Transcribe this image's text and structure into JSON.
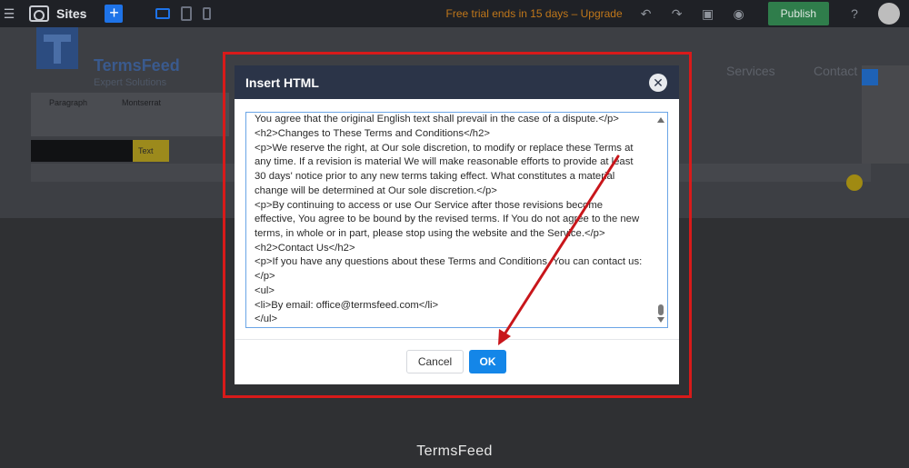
{
  "topbar": {
    "sites_label": "Sites",
    "trial_text": "Free trial ends in 15 days – Upgrade",
    "publish_label": "Publish"
  },
  "website": {
    "brand_name": "TermsFeed",
    "brand_tagline": "Expert Solutions",
    "nav": [
      "Services",
      "Contact"
    ],
    "toolbar_paragraph": "Paragraph",
    "toolbar_font": "Montserrat",
    "text_tag": "Text",
    "footer_brand": "TermsFeed"
  },
  "modal": {
    "title": "Insert HTML",
    "lines": [
      "You agree that the original English text shall prevail in the case of a dispute.</p>",
      "<h2>Changes to These Terms and Conditions</h2>",
      "<p>We reserve the right, at Our sole discretion, to modify or replace these Terms at",
      "any time. If a revision is material We will make reasonable efforts to provide at least",
      "30 days' notice prior to any new terms taking effect. What constitutes a material",
      "change will be determined at Our sole discretion.</p>",
      "<p>By continuing to access or use Our Service after those revisions become",
      "effective, You agree to be bound by the revised terms. If You do not agree to the new",
      "terms, in whole or in part, please stop using the website and the Service.</p>",
      "<h2>Contact Us</h2>",
      "<p>If you have any questions about these Terms and Conditions, You can contact us:",
      "</p>",
      "<ul>",
      "<li>By email: office@termsfeed.com</li>",
      "</ul>"
    ],
    "cancel_label": "Cancel",
    "ok_label": "OK"
  },
  "colors": {
    "highlight": "#d81a1a",
    "arrow": "#c8161b",
    "ok_button": "#1486e8",
    "modal_header": "#2b3448"
  }
}
